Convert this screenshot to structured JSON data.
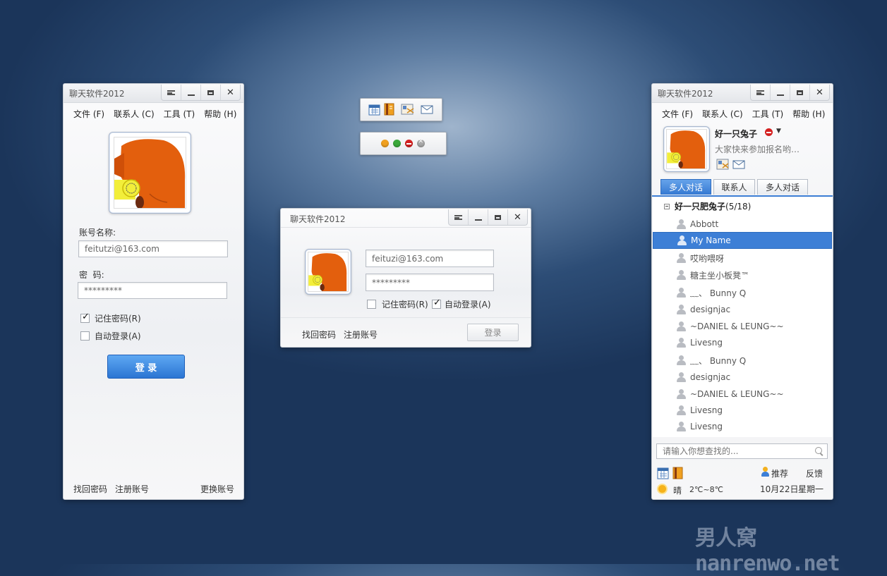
{
  "app_title": "聊天软件2012",
  "menu": [
    "文件 (F)",
    "联系人 (C)",
    "工具 (T)",
    "帮助 (H)"
  ],
  "login_tall": {
    "account_label": "账号名称:",
    "account_value": "feitutzi@163.com",
    "password_label": "密  码:",
    "password_value": "*********",
    "remember_label": "记住密码(R)",
    "remember_checked": true,
    "autologin_label": "自动登录(A)",
    "autologin_checked": false,
    "login_button": "登 录",
    "forgot": "找回密码",
    "register": "注册账号",
    "switch_account": "更换账号"
  },
  "login_compact": {
    "account_value": "feituzi@163.com",
    "password_value": "*********",
    "remember_label": "记住密码(R)",
    "remember_checked": false,
    "autologin_label": "自动登录(A)",
    "autologin_checked": true,
    "forgot": "找回密码",
    "register": "注册账号",
    "login_button": "登录"
  },
  "toolbar_icons": [
    "calendar-icon",
    "notebook-icon",
    "mail-card-icon",
    "envelope-icon"
  ],
  "status_icons": [
    {
      "name": "away-status-icon",
      "color": "#f0a020"
    },
    {
      "name": "online-status-icon",
      "color": "#3aa83a"
    },
    {
      "name": "busy-status-icon",
      "color": "#d42020"
    },
    {
      "name": "offline-status-icon",
      "color": "#a8a8a8"
    }
  ],
  "main_panel": {
    "nickname": "好一只兔子",
    "signature": "大家快来参加报名哟…",
    "tabs": [
      "多人对话",
      "联系人",
      "多人对话"
    ],
    "active_tab": 0,
    "group_name": "好一只肥兔子",
    "group_count": "(5/18)",
    "contacts": [
      "Abbott",
      "My Name",
      "哎哟喂呀",
      "糖主坐小板凳™",
      "﹏、 Bunny Q",
      "designjac",
      "~DANIEL & LEUNG~~",
      "Livesng",
      "﹏、 Bunny Q",
      "designjac",
      "~DANIEL & LEUNG~~",
      "Livesng",
      "Livesng"
    ],
    "selected_contact": 1,
    "search_placeholder": "请输入你想查找的...",
    "recommend": "推荐",
    "feedback": "反馈",
    "weather": "晴",
    "temperature": "2℃~8℃",
    "date": "10月22日",
    "weekday": "星期一"
  },
  "watermark": "男人窝nanrenwo.net",
  "colors": {
    "accent": "#3d7fd6",
    "avatar_orange": "#e35f0d",
    "avatar_yellow": "#f2ee3a"
  }
}
